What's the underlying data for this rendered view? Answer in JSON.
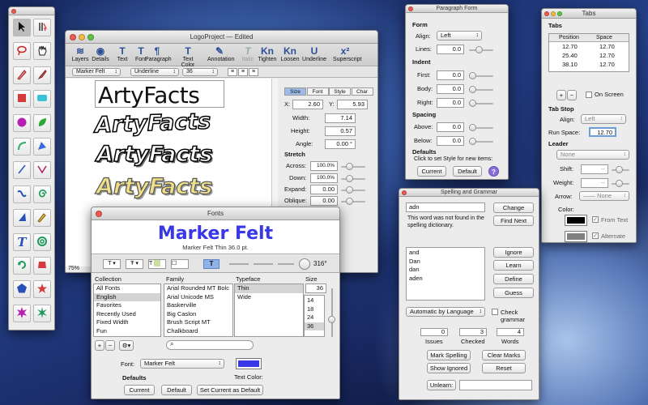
{
  "tools": {
    "items": [
      "pointer",
      "text-cursor",
      "lasso",
      "hand",
      "pencil",
      "brush",
      "rectangle",
      "rounded-rectangle",
      "circle",
      "leaf",
      "arc",
      "polygon",
      "line",
      "v-shape",
      "squiggle",
      "spiral",
      "wedge",
      "pen",
      "text",
      "swirl",
      "rotate",
      "stamp",
      "pentagon",
      "star-shape",
      "starburst",
      "star"
    ]
  },
  "main": {
    "title": "LogoProject — Edited",
    "toolbar": [
      "Layers",
      "Details",
      "Text",
      "Font",
      "Paragraph",
      "Text Color",
      "Annotation",
      "Italic",
      "Tighten",
      "Loosen",
      "Underline",
      "Superscript"
    ],
    "toolbar_icons": [
      "≋",
      "◉",
      "T",
      "T",
      "¶",
      "T",
      "✎",
      "T",
      "Kn",
      "Kn",
      "U",
      "x²"
    ],
    "font_popup": "Marker Felt",
    "underline_popup": "Underline",
    "size_popup": "36",
    "samples": [
      "ArtyFacts",
      "ArtyFacts",
      "ArtyFacts",
      "ArtyFacts"
    ],
    "zoom": "75%",
    "tabs": [
      "Size",
      "Font",
      "Style",
      "Char"
    ],
    "x_label": "X:",
    "x_value": "2.60",
    "y_label": "Y:",
    "y_value": "5.93",
    "width_label": "Width:",
    "width_value": "7.14",
    "height_label": "Height:",
    "height_value": "0.57",
    "angle_label": "Angle:",
    "angle_value": "0.00 °",
    "stretch_header": "Stretch",
    "across_label": "Across:",
    "across_value": "100.0%",
    "down_label": "Down:",
    "down_value": "100.0%",
    "expand_label": "Expand:",
    "expand_value": "0.00",
    "oblique_label": "Oblique:",
    "oblique_value": "0.00"
  },
  "fonts": {
    "title": "Fonts",
    "preview_name": "Marker Felt",
    "preview_sub": "Marker Felt Thin 36.0 pt.",
    "rotation": "316°",
    "headers": [
      "Collection",
      "Family",
      "Typeface",
      "Size"
    ],
    "collections": [
      "All Fonts",
      "English",
      "Favorites",
      "Recently Used",
      "Fixed Width",
      "Fun"
    ],
    "families": [
      "Arial Rounded MT Bolc",
      "Arial Unicode MS",
      "Baskerville",
      "Big Caslon",
      "Brush Script MT",
      "Chalkboard"
    ],
    "typefaces": [
      "Thin",
      "Wide"
    ],
    "size_value": "36",
    "sizes": [
      "14",
      "18",
      "24",
      "36"
    ],
    "font_label": "Font:",
    "font_value": "Marker Felt",
    "text_color_label": "Text Color:",
    "text_color": "#3a37e8",
    "defaults_label": "Defaults",
    "current_btn": "Current",
    "default_btn": "Default",
    "set_current_btn": "Set Current as Default"
  },
  "paragraph": {
    "title": "Paragraph Form",
    "form_header": "Form",
    "align_label": "Align:",
    "align_value": "Left",
    "lines_label": "Lines:",
    "lines_value": "0.0",
    "indent_header": "Indent",
    "first_label": "First:",
    "first_value": "0.0",
    "body_label": "Body:",
    "body_value": "0.0",
    "right_label": "Right:",
    "right_value": "0.0",
    "spacing_header": "Spacing",
    "above_label": "Above:",
    "above_value": "0.0",
    "below_label": "Below:",
    "below_value": "0.0",
    "defaults_header": "Defaults",
    "defaults_text": "Click to set Style for new items:",
    "current_btn": "Current",
    "default_btn": "Default",
    "help": "?"
  },
  "tabs_panel": {
    "title": "Tabs",
    "tabs_header": "Tabs",
    "col_position": "Position",
    "col_space": "Space",
    "rows": [
      [
        "12.70",
        "12.70"
      ],
      [
        "25.40",
        "12.70"
      ],
      [
        "38.10",
        "12.70"
      ]
    ],
    "add": "+",
    "remove": "−",
    "on_screen": "On Screen",
    "tab_stop_header": "Tab Stop",
    "align_label": "Align:",
    "align_value": "Left",
    "run_space_label": "Run Space:",
    "run_space_value": "12.70",
    "leader_header": "Leader",
    "leader_value": "None",
    "shift_label": "Shift:",
    "shift_value": "--",
    "weight_label": "Weight:",
    "weight_value": "--",
    "arrow_label": "Arrow:",
    "arrow_value": "—— None",
    "color_label": "Color:",
    "from_text": "From Text",
    "alternate": "Alternate"
  },
  "spelling": {
    "title": "Spelling and Grammar",
    "word": "adn",
    "message": "This word was not found in the spelling dictionary.",
    "change_btn": "Change",
    "find_next_btn": "Find Next",
    "guesses": [
      "and",
      "Dan",
      "dan",
      "aden"
    ],
    "ignore_btn": "Ignore",
    "learn_btn": "Learn",
    "define_btn": "Define",
    "guess_btn": "Guess",
    "language": "Automatic by Language",
    "check_grammar": "Check grammar",
    "issues_value": "0",
    "issues_label": "Issues",
    "checked_value": "3",
    "checked_label": "Checked",
    "words_value": "4",
    "words_label": "Words",
    "mark_btn": "Mark Spelling",
    "clear_btn": "Clear Marks",
    "show_ignored_btn": "Show Ignored",
    "reset_btn": "Reset",
    "unlearn_btn": "Unlearn:"
  }
}
